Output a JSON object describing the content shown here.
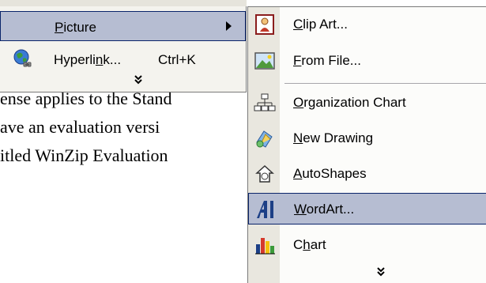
{
  "document": {
    "lines": [
      "ense applies to the Stand",
      "ave an evaluation versi",
      "itled WinZip Evaluation"
    ]
  },
  "insert_menu": {
    "items": [
      {
        "label": "Picture",
        "mnemonic_index": 0,
        "has_submenu": true,
        "highlighted": true
      },
      {
        "label": "Hyperlink...",
        "mnemonic_index": 7,
        "shortcut": "Ctrl+K",
        "icon": "hyperlink-globe-icon"
      }
    ],
    "more_glyph": "»"
  },
  "picture_submenu": {
    "items": [
      {
        "label": "Clip Art...",
        "icon": "clip-art-icon"
      },
      {
        "label": "From File...",
        "icon": "from-file-icon"
      },
      {
        "label": "Organization Chart",
        "icon": "organization-chart-icon"
      },
      {
        "label": "New Drawing",
        "icon": "new-drawing-icon"
      },
      {
        "label": "AutoShapes",
        "icon": "autoshapes-icon"
      },
      {
        "label": "WordArt...",
        "icon": "wordart-icon",
        "highlighted": true
      },
      {
        "label": "Chart",
        "icon": "chart-icon"
      }
    ],
    "more_glyph": "»"
  },
  "colors": {
    "menu_bg": "#f4f3ee",
    "icon_column": "#e9e7df",
    "highlight": "#b6bdd2",
    "highlight_border": "#0a246a"
  }
}
